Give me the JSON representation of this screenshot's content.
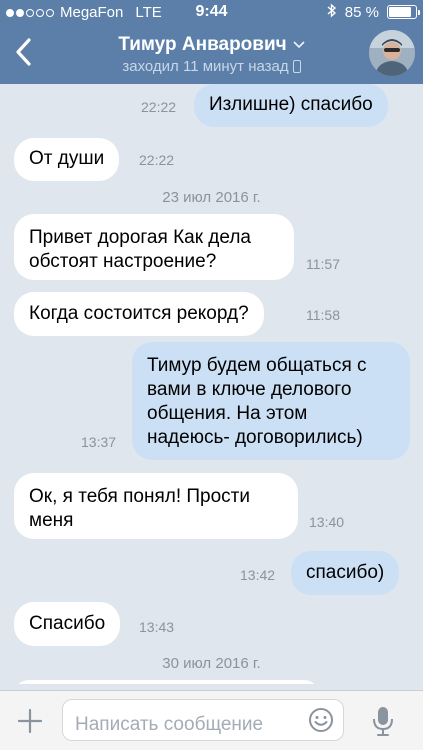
{
  "status_bar": {
    "carrier": "MegaFon",
    "network": "LTE",
    "time": "9:44",
    "battery_percent": "85 %",
    "battery_level": 0.85,
    "signal_bars_filled": 2,
    "signal_bars_total": 5
  },
  "chat_header": {
    "contact_name": "Тимур Анварович",
    "last_seen": "заходил 11 минут назад",
    "back_icon": "chevron-left-icon",
    "accent_color": "#5b7fa8"
  },
  "messages": [
    {
      "direction": "out",
      "text": "Излишне) спасибо",
      "time": "22:22"
    },
    {
      "direction": "in",
      "text": "От души",
      "time": "22:22"
    },
    {
      "type": "date",
      "text": "23 июл 2016 г."
    },
    {
      "direction": "in",
      "lines": [
        "Привет дорогая Как дела",
        "обстоят настроение?"
      ],
      "time": "11:57"
    },
    {
      "direction": "in",
      "text": "Когда состоится рекорд?",
      "time": "11:58"
    },
    {
      "direction": "out",
      "lines": [
        "Тимур будем общаться с",
        "вами в ключе делового",
        "общения. На этом",
        "надеюсь- договорились)"
      ],
      "time": "13:37"
    },
    {
      "direction": "in",
      "lines": [
        "Ок,  я тебя понял! Прости",
        "меня"
      ],
      "time": "13:40"
    },
    {
      "direction": "out",
      "text": "спасибо)",
      "time": "13:42"
    },
    {
      "direction": "in",
      "text": "Спасибо",
      "time": "13:43"
    },
    {
      "type": "date",
      "text": "30 июл 2016 г."
    }
  ],
  "composer": {
    "placeholder": "Написать сообщение"
  }
}
